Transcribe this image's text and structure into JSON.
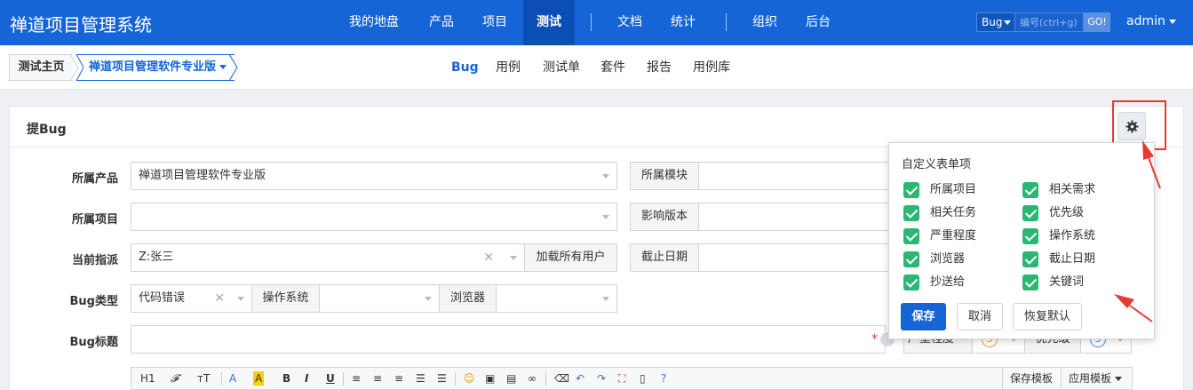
{
  "app": {
    "title": "禅道项目管理系统",
    "nav": [
      "我的地盘",
      "产品",
      "项目",
      "测试",
      "文档",
      "统计",
      "组织",
      "后台"
    ],
    "nav_active": "测试",
    "search_type": "Bug",
    "search_placeholder": "编号(ctrl+g)",
    "go_label": "GO!",
    "user": "admin"
  },
  "subnav": {
    "home": "测试主页",
    "product": "禅道项目管理软件专业版",
    "items": [
      "Bug",
      "用例",
      "测试单",
      "套件",
      "报告",
      "用例库"
    ],
    "active": "Bug"
  },
  "form": {
    "title": "提Bug",
    "product_label": "所属产品",
    "product_value": "禅道项目管理软件专业版",
    "module_label": "所属模块",
    "project_label": "所属项目",
    "build_label": "影响版本",
    "assign_label": "当前指派",
    "assign_value": "Z:张三",
    "load_users": "加载所有用户",
    "deadline_label": "截止日期",
    "type_label": "Bug类型",
    "type_value": "代码错误",
    "os_label": "操作系统",
    "browser_label": "浏览器",
    "bug_title_label": "Bug标题",
    "severity_label": "严重程度",
    "severity_value": "3",
    "priority_label": "优先级",
    "priority_value": "3"
  },
  "editor": {
    "tools": [
      "H1",
      "𝓕",
      "тT",
      "A",
      "A",
      "B",
      "I",
      "U"
    ],
    "save_template": "保存模板",
    "apply_template": "应用模板"
  },
  "custom_popup": {
    "title": "自定义表单项",
    "items": [
      {
        "label": "所属项目",
        "checked": true
      },
      {
        "label": "相关需求",
        "checked": true
      },
      {
        "label": "相关任务",
        "checked": true
      },
      {
        "label": "优先级",
        "checked": true
      },
      {
        "label": "严重程度",
        "checked": true
      },
      {
        "label": "操作系统",
        "checked": true
      },
      {
        "label": "浏览器",
        "checked": true
      },
      {
        "label": "截止日期",
        "checked": true
      },
      {
        "label": "抄送给",
        "checked": true
      },
      {
        "label": "关键词",
        "checked": true
      }
    ],
    "save": "保存",
    "cancel": "取消",
    "reset": "恢复默认"
  },
  "colors": {
    "brand": "#1565d6",
    "check": "#2bb673",
    "annotation": "#e53935"
  }
}
